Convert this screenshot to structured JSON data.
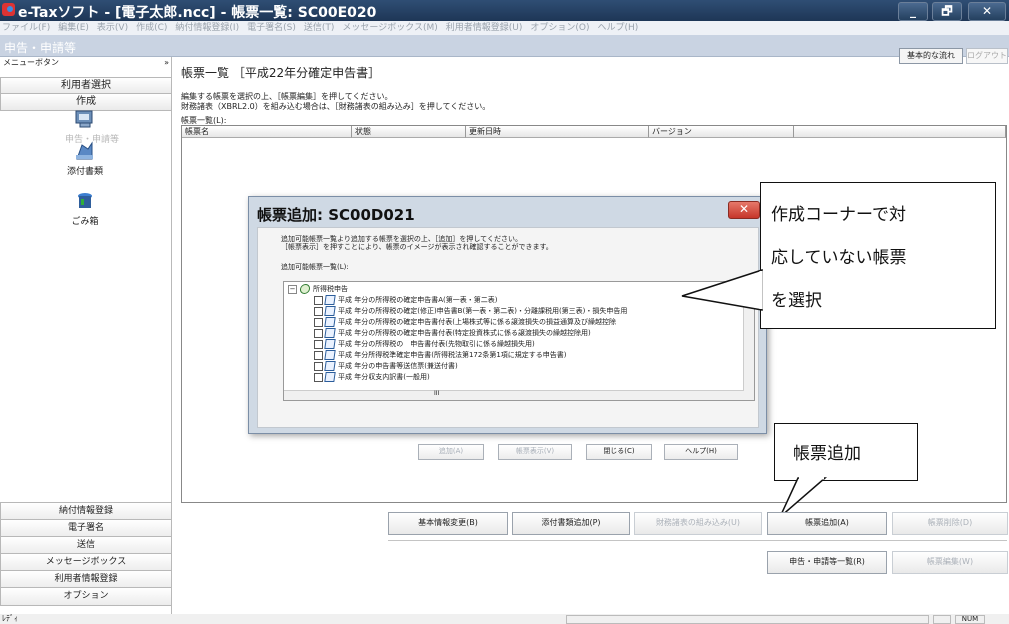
{
  "window": {
    "title": "e-Taxソフト - [電子太郎.ncc] - 帳票一覧: SC00E020",
    "minimize": "_",
    "maximize": "🗗",
    "close": "✕"
  },
  "menu": [
    "ファイル(F)",
    "編集(E)",
    "表示(V)",
    "作成(C)",
    "納付情報登録(I)",
    "電子署名(S)",
    "送信(T)",
    "メッセージボックス(M)",
    "利用者情報登録(U)",
    "オプション(O)",
    "ヘルプ(H)"
  ],
  "header": {
    "section": "申告・申請等",
    "basic_flow": "基本的な流れ",
    "logout": "ログアウト"
  },
  "sidebar": {
    "menu_label": "メニューボタン",
    "collapse": "»",
    "items_top": [
      "利用者選択",
      "作成"
    ],
    "icons": [
      {
        "label": "申告・申請等",
        "icon": "form-icon"
      },
      {
        "label": "添付書類",
        "icon": "attachment-icon"
      },
      {
        "label": "ごみ箱",
        "icon": "trash-icon"
      }
    ],
    "items_bottom": [
      "納付情報登録",
      "電子署名",
      "送信",
      "メッセージボックス",
      "利用者情報登録",
      "オプション"
    ]
  },
  "main": {
    "title": "帳票一覧 ［平成22年分確定申告書］",
    "instruction1": "編集する帳票を選択の上、［帳票編集］を押してください。",
    "instruction2": "財務諸表（XBRL2.0）を組み込む場合は、［財務諸表の組み込み］を押してください。",
    "list_label": "帳票一覧(L):",
    "columns": [
      "帳票名",
      "状態",
      "更新日時",
      "バージョン"
    ]
  },
  "dialog": {
    "title": "帳票追加: SC00D021",
    "message1": "追加可能帳票一覧より追加する帳票を選択の上、［追加］を押してください。",
    "message2": "［帳票表示］を押すことにより、帳票のイメージが表示され確認することができます。",
    "list_label": "追加可能帳票一覧(L):",
    "tree_root": "所得税申告",
    "tree_items": [
      "平成 年分の所得税の確定申告書A(第一表・第二表)",
      "平成 年分の所得税の確定(修正)申告書B(第一表・第二表)・分離課税用(第三表)・損失申告用",
      "平成 年分の所得税の確定申告書付表(上場株式等に係る譲渡損失の損益通算及び繰越控除",
      "平成 年分の所得税の確定申告書付表(特定投資株式に係る譲渡損失の繰越控除用)",
      "平成 年分の所得税の　申告書付表(先物取引に係る繰越損失用)",
      "平成 年分所得税準確定申告書(所得税法第172条第1項に規定する申告書)",
      "平成 年分の申告書等送信票(兼送付書)",
      "平成 年分収支内訳書(一般用)"
    ],
    "scroll_mark": "III",
    "buttons": {
      "add": "追加(A)",
      "show": "帳票表示(V)",
      "close": "閉じる(C)",
      "help": "ヘルプ(H)"
    }
  },
  "callouts": {
    "dialog_note": [
      "作成コーナーで対",
      "応していない帳票",
      "を選択"
    ],
    "add_note": "帳票追加"
  },
  "bottom_buttons": {
    "basic_info": "基本情報変更(B)",
    "attach": "添付書類追加(P)",
    "financial": "財務諸表の組み込み(U)",
    "add_form": "帳票追加(A)",
    "delete_form": "帳票削除(D)",
    "apply_list": "申告・申請等一覧(R)",
    "edit_form": "帳票編集(W)"
  },
  "status": {
    "left": "ﾚﾃﾞｨ",
    "num": "NUM"
  }
}
